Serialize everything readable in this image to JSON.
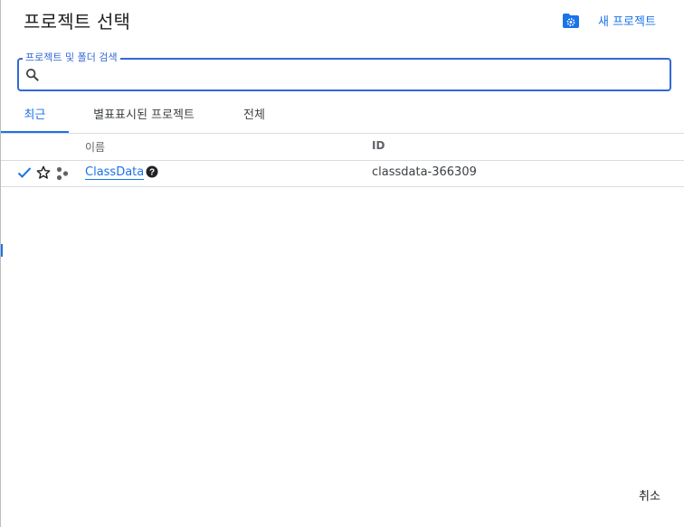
{
  "dialog": {
    "title": "프로젝트 선택",
    "new_project_label": "새 프로젝트",
    "header_icon": "folder-settings-icon"
  },
  "search": {
    "label": "프로젝트 및 폴더 검색",
    "value": "",
    "icon": "search-icon"
  },
  "tabs": [
    {
      "label": "최근",
      "active": true
    },
    {
      "label": "별표표시된 프로젝트",
      "active": false
    },
    {
      "label": "전체",
      "active": false
    }
  ],
  "table": {
    "columns": [
      "이름",
      "ID"
    ],
    "rows": [
      {
        "selected": true,
        "starred": false,
        "name": "ClassData",
        "id": "classdata-366309",
        "icons": [
          "check-icon",
          "star-outline-icon",
          "organization-icon",
          "help-icon"
        ]
      }
    ]
  },
  "footer": {
    "cancel_label": "취소"
  },
  "colors": {
    "accent": "#1a73e8",
    "search_border": "#3367d6",
    "divider": "#dadce0",
    "icon_dark": "#202124"
  }
}
